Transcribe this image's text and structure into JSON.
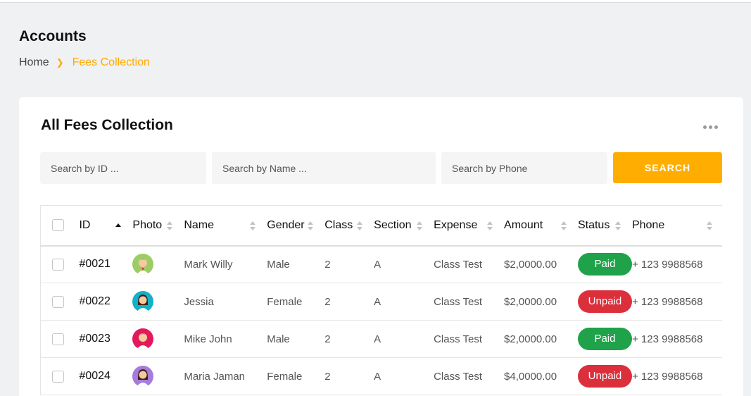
{
  "header": {
    "title": "Accounts",
    "breadcrumb": {
      "home": "Home",
      "separator": ">",
      "current": "Fees Collection"
    }
  },
  "card": {
    "title": "All Fees Collection",
    "menu_icon": "more-horizontal-icon"
  },
  "search": {
    "id_placeholder": "Search by ID ...",
    "name_placeholder": "Search by Name ...",
    "phone_placeholder": "Search by Phone",
    "button_label": "SEARCH"
  },
  "colors": {
    "accent": "#ffae01",
    "paid": "#1fa24a",
    "unpaid": "#dc2f3c"
  },
  "table": {
    "columns": [
      "ID",
      "Photo",
      "Name",
      "Gender",
      "Class",
      "Section",
      "Expense",
      "Amount",
      "Status",
      "Phone"
    ],
    "rows": [
      {
        "id": "#0021",
        "avatar": "male-avatar-icon",
        "avatar_bg": "#9ccc65",
        "name": "Mark Willy",
        "gender": "Male",
        "class": "2",
        "section": "A",
        "expense": "Class Test",
        "amount": "$2,0000.00",
        "status": "Paid",
        "phone": "+ 123 9988568"
      },
      {
        "id": "#0022",
        "avatar": "female-avatar-icon",
        "avatar_bg": "#12b1c8",
        "name": "Jessia",
        "gender": "Female",
        "class": "2",
        "section": "A",
        "expense": "Class Test",
        "amount": "$2,0000.00",
        "status": "Unpaid",
        "phone": "+ 123 9988568"
      },
      {
        "id": "#0023",
        "avatar": "male-avatar-icon",
        "avatar_bg": "#e4185c",
        "name": "Mike John",
        "gender": "Male",
        "class": "2",
        "section": "A",
        "expense": "Class Test",
        "amount": "$2,0000.00",
        "status": "Paid",
        "phone": "+ 123 9988568"
      },
      {
        "id": "#0024",
        "avatar": "female-avatar-icon",
        "avatar_bg": "#a67bd9",
        "name": "Maria Jaman",
        "gender": "Female",
        "class": "2",
        "section": "A",
        "expense": "Class Test",
        "amount": "$4,0000.00",
        "status": "Unpaid",
        "phone": "+ 123 9988568"
      }
    ]
  }
}
